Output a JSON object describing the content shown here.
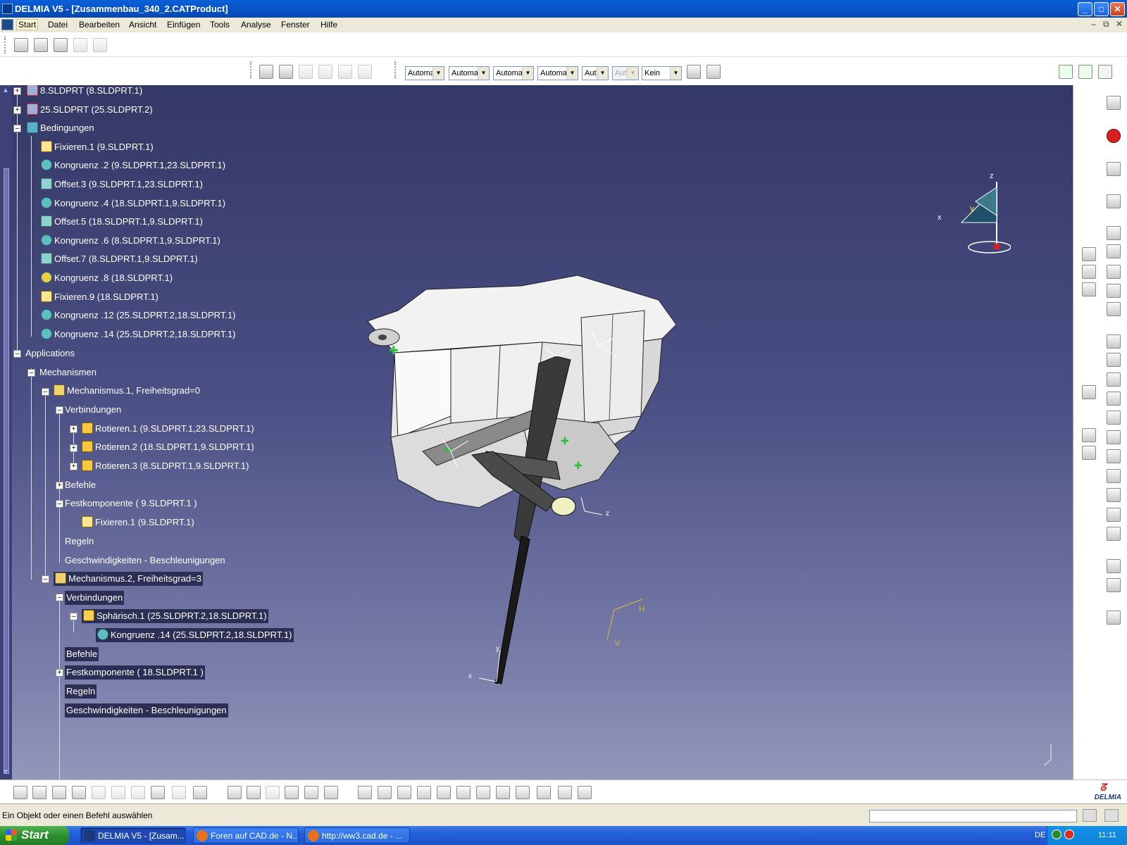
{
  "window": {
    "title": "DELMIA V5 - [Zusammenbau_340_2.CATProduct]",
    "controls": {
      "minimize": "_",
      "maximize": "□",
      "close": "✕"
    },
    "mdi_controls": {
      "minimize": "–",
      "restore": "⧉",
      "close": "✕"
    }
  },
  "menu": [
    "Start",
    "Datei",
    "Bearbeiten",
    "Ansicht",
    "Einfügen",
    "Tools",
    "Analyse",
    "Fenster",
    "Hilfe"
  ],
  "combos": [
    "Automa",
    "Automa",
    "Automa",
    "Automa",
    "Aut",
    "Aut",
    "Kein"
  ],
  "tree": [
    {
      "text": "8.SLDPRT (8.SLDPRT.1)",
      "icon": "part-icon"
    },
    {
      "text": "25.SLDPRT (25.SLDPRT.2)",
      "icon": "part-icon"
    },
    {
      "text": "Bedingungen",
      "icon": "constraints-icon"
    },
    {
      "text": "Fixieren.1 (9.SLDPRT.1)",
      "icon": "fix-icon"
    },
    {
      "text": "Kongruenz .2 (9.SLDPRT.1,23.SLDPRT.1)",
      "icon": "coincidence-icon"
    },
    {
      "text": "Offset.3 (9.SLDPRT.1,23.SLDPRT.1)",
      "icon": "offset-icon"
    },
    {
      "text": "Kongruenz .4 (18.SLDPRT.1,9.SLDPRT.1)",
      "icon": "coincidence-icon"
    },
    {
      "text": "Offset.5 (18.SLDPRT.1,9.SLDPRT.1)",
      "icon": "offset-icon"
    },
    {
      "text": "Kongruenz .6 (8.SLDPRT.1,9.SLDPRT.1)",
      "icon": "coincidence-icon"
    },
    {
      "text": "Offset.7 (8.SLDPRT.1,9.SLDPRT.1)",
      "icon": "offset-icon"
    },
    {
      "text": "Kongruenz .8 (18.SLDPRT.1)",
      "icon": "coincidence-warning-icon"
    },
    {
      "text": "Fixieren.9 (18.SLDPRT.1)",
      "icon": "fix-icon"
    },
    {
      "text": "Kongruenz .12 (25.SLDPRT.2,18.SLDPRT.1)",
      "icon": "coincidence-icon"
    },
    {
      "text": "Kongruenz .14 (25.SLDPRT.2,18.SLDPRT.1)",
      "icon": "coincidence-icon"
    },
    {
      "text": "Applications",
      "icon": ""
    },
    {
      "text": "Mechanismen",
      "icon": ""
    },
    {
      "text": "Mechanismus.1, Freiheitsgrad=0",
      "icon": "mechanism-icon"
    },
    {
      "text": "Verbindungen",
      "icon": ""
    },
    {
      "text": "Rotieren.1 (9.SLDPRT.1,23.SLDPRT.1)",
      "icon": "revolute-icon"
    },
    {
      "text": "Rotieren.2 (18.SLDPRT.1,9.SLDPRT.1)",
      "icon": "revolute-icon"
    },
    {
      "text": "Rotieren.3 (8.SLDPRT.1,9.SLDPRT.1)",
      "icon": "revolute-icon"
    },
    {
      "text": "Befehle",
      "icon": ""
    },
    {
      "text": "Festkomponente ( 9.SLDPRT.1 )",
      "icon": ""
    },
    {
      "text": "Fixieren.1 (9.SLDPRT.1)",
      "icon": "fix-icon"
    },
    {
      "text": "Regeln",
      "icon": ""
    },
    {
      "text": "Geschwindigkeiten - Beschleunigungen",
      "icon": ""
    },
    {
      "text": "Mechanismus.2, Freiheitsgrad=3",
      "icon": "mechanism-icon"
    },
    {
      "text": "Verbindungen",
      "icon": ""
    },
    {
      "text": "Sphärisch.1 (25.SLDPRT.2,18.SLDPRT.1)",
      "icon": "spherical-icon"
    },
    {
      "text": "Kongruenz .14 (25.SLDPRT.2,18.SLDPRT.1)",
      "icon": "coincidence-icon"
    },
    {
      "text": "Befehle",
      "icon": ""
    },
    {
      "text": "Festkomponente ( 18.SLDPRT.1 )",
      "icon": ""
    },
    {
      "text": "Regeln",
      "icon": ""
    },
    {
      "text": "Geschwindigkeiten - Beschleunigungen",
      "icon": ""
    }
  ],
  "compass": {
    "x": "x",
    "y": "y",
    "z": "z"
  },
  "viewport_axes": {
    "h": "H",
    "v": "V",
    "x": "x",
    "y": "y",
    "z": "z"
  },
  "status": {
    "message": "Ein Objekt oder einen Befehl auswählen",
    "input_value": ""
  },
  "brand": "DELMIA",
  "taskbar": {
    "start": "Start",
    "tasks": [
      "DELMIA V5 - [Zusam...",
      "Foren auf CAD.de - N...",
      "http://ww3.cad.de - ..."
    ],
    "lang": "DE",
    "clock": "11:11"
  },
  "colors": {
    "viewport_top": "#343866",
    "viewport_bottom": "#9397b9",
    "selection_bg": "#2c2f55"
  }
}
